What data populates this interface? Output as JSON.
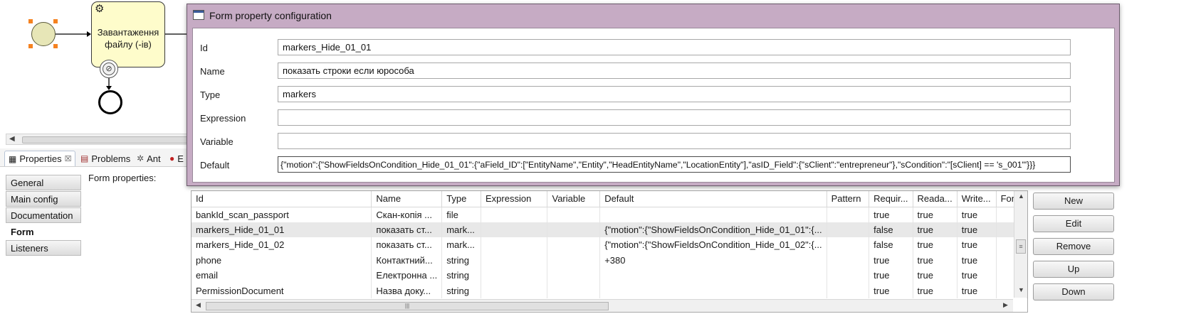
{
  "diagram": {
    "task_label": "Завантаження файлу (-ів)",
    "icons": {
      "task": "gear-icon",
      "boundary": "no-entry-icon"
    }
  },
  "views": {
    "tabs": [
      {
        "label": "Properties",
        "icon": "properties-icon",
        "active": true
      },
      {
        "label": "Problems",
        "icon": "problems-icon"
      },
      {
        "label": "Ant",
        "icon": "ant-icon"
      },
      {
        "label": "E",
        "icon": "error-log-icon"
      }
    ],
    "properties_close_glyph": "☒"
  },
  "properties": {
    "nav": [
      "General",
      "Main config",
      "Documentation",
      "Form",
      "Listeners"
    ],
    "active_nav": "Form",
    "form_label": "Form properties:"
  },
  "table": {
    "columns": [
      "Id",
      "Name",
      "Type",
      "Expression",
      "Variable",
      "Default",
      "Pattern",
      "Requir...",
      "Reada...",
      "Write...",
      "Form"
    ],
    "rows": [
      [
        "bankId_scan_passport",
        "Скан-копія ...",
        "file",
        "",
        "",
        "",
        "",
        "true",
        "true",
        "true",
        ""
      ],
      [
        "markers_Hide_01_01",
        "показать ст...",
        "mark...",
        "",
        "",
        "{\"motion\":{\"ShowFieldsOnCondition_Hide_01_01\":{...",
        "",
        "false",
        "true",
        "true",
        ""
      ],
      [
        "markers_Hide_01_02",
        "показать ст...",
        "mark...",
        "",
        "",
        "{\"motion\":{\"ShowFieldsOnCondition_Hide_01_02\":{...",
        "",
        "false",
        "true",
        "true",
        ""
      ],
      [
        "phone",
        "Контактний...",
        "string",
        "",
        "",
        "+380",
        "",
        "true",
        "true",
        "true",
        ""
      ],
      [
        "email",
        "Електронна ...",
        "string",
        "",
        "",
        "",
        "",
        "true",
        "true",
        "true",
        ""
      ],
      [
        "PermissionDocument",
        "Назва доку...",
        "string",
        "",
        "",
        "",
        "",
        "true",
        "true",
        "true",
        ""
      ]
    ],
    "selected_row": 1
  },
  "buttons": {
    "new": "New",
    "edit": "Edit",
    "remove": "Remove",
    "up": "Up",
    "down": "Down"
  },
  "dialog": {
    "title": "Form property configuration",
    "fields": {
      "id": {
        "label": "Id",
        "value": "markers_Hide_01_01"
      },
      "name": {
        "label": "Name",
        "value": "показать строки если юрособа"
      },
      "type": {
        "label": "Type",
        "value": "markers"
      },
      "expression": {
        "label": "Expression",
        "value": ""
      },
      "variable": {
        "label": "Variable",
        "value": ""
      },
      "default": {
        "label": "Default",
        "value": "{\"motion\":{\"ShowFieldsOnCondition_Hide_01_01\":{\"aField_ID\":[\"EntityName\",\"Entity\",\"HeadEntityName\",\"LocationEntity\"],\"asID_Field\":{\"sClient\":\"entrepreneur\"},\"sCondition\":\"[sClient] == 's_001'\"}}}"
      }
    }
  }
}
